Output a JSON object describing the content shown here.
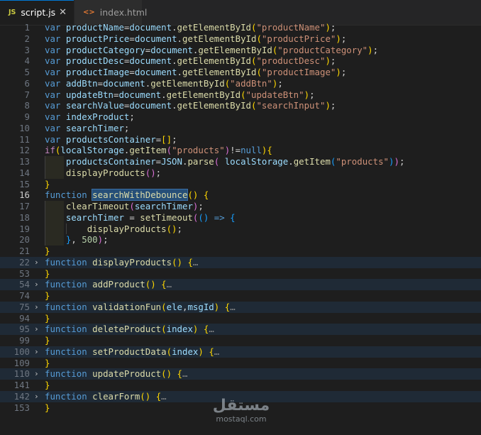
{
  "tabs": [
    {
      "icon": "JS",
      "label": "script.js",
      "close": "✕"
    },
    {
      "icon": "<>",
      "label": "index.html"
    }
  ],
  "lines": [
    {
      "n": "1",
      "t": [
        [
          "kw",
          "var"
        ],
        [
          "op",
          " "
        ],
        [
          "vr",
          "productName"
        ],
        [
          "op",
          "="
        ],
        [
          "vr",
          "document"
        ],
        [
          "op",
          "."
        ],
        [
          "fn",
          "getElementById"
        ],
        [
          "b1",
          "("
        ],
        [
          "st",
          "\"productName\""
        ],
        [
          "b1",
          ")"
        ],
        [
          "op",
          ";"
        ]
      ]
    },
    {
      "n": "2",
      "t": [
        [
          "kw",
          "var"
        ],
        [
          "op",
          " "
        ],
        [
          "vr",
          "productPrice"
        ],
        [
          "op",
          "="
        ],
        [
          "vr",
          "document"
        ],
        [
          "op",
          "."
        ],
        [
          "fn",
          "getElementById"
        ],
        [
          "b1",
          "("
        ],
        [
          "st",
          "\"productPrice\""
        ],
        [
          "b1",
          ")"
        ],
        [
          "op",
          ";"
        ]
      ]
    },
    {
      "n": "3",
      "t": [
        [
          "kw",
          "var"
        ],
        [
          "op",
          " "
        ],
        [
          "vr",
          "productCategory"
        ],
        [
          "op",
          "="
        ],
        [
          "vr",
          "document"
        ],
        [
          "op",
          "."
        ],
        [
          "fn",
          "getElementById"
        ],
        [
          "b1",
          "("
        ],
        [
          "st",
          "\"productCategory\""
        ],
        [
          "b1",
          ")"
        ],
        [
          "op",
          ";"
        ]
      ]
    },
    {
      "n": "4",
      "t": [
        [
          "kw",
          "var"
        ],
        [
          "op",
          " "
        ],
        [
          "vr",
          "productDesc"
        ],
        [
          "op",
          "="
        ],
        [
          "vr",
          "document"
        ],
        [
          "op",
          "."
        ],
        [
          "fn",
          "getElementById"
        ],
        [
          "b1",
          "("
        ],
        [
          "st",
          "\"productDesc\""
        ],
        [
          "b1",
          ")"
        ],
        [
          "op",
          ";"
        ]
      ]
    },
    {
      "n": "5",
      "t": [
        [
          "kw",
          "var"
        ],
        [
          "op",
          " "
        ],
        [
          "vr",
          "productImage"
        ],
        [
          "op",
          "="
        ],
        [
          "vr",
          "document"
        ],
        [
          "op",
          "."
        ],
        [
          "fn",
          "getElementById"
        ],
        [
          "b1",
          "("
        ],
        [
          "st",
          "\"productImage\""
        ],
        [
          "b1",
          ")"
        ],
        [
          "op",
          ";"
        ]
      ]
    },
    {
      "n": "6",
      "t": [
        [
          "kw",
          "var"
        ],
        [
          "op",
          " "
        ],
        [
          "vr",
          "addBtn"
        ],
        [
          "op",
          "="
        ],
        [
          "vr",
          "document"
        ],
        [
          "op",
          "."
        ],
        [
          "fn",
          "getElementById"
        ],
        [
          "b1",
          "("
        ],
        [
          "st",
          "\"addBtn\""
        ],
        [
          "b1",
          ")"
        ],
        [
          "op",
          ";"
        ]
      ]
    },
    {
      "n": "7",
      "t": [
        [
          "kw",
          "var"
        ],
        [
          "op",
          " "
        ],
        [
          "vr",
          "updateBtn"
        ],
        [
          "op",
          "="
        ],
        [
          "vr",
          "document"
        ],
        [
          "op",
          "."
        ],
        [
          "fn",
          "getElementById"
        ],
        [
          "b1",
          "("
        ],
        [
          "st",
          "\"updateBtn\""
        ],
        [
          "b1",
          ")"
        ],
        [
          "op",
          ";"
        ]
      ]
    },
    {
      "n": "8",
      "t": [
        [
          "kw",
          "var"
        ],
        [
          "op",
          " "
        ],
        [
          "vr",
          "searchValue"
        ],
        [
          "op",
          "="
        ],
        [
          "vr",
          "document"
        ],
        [
          "op",
          "."
        ],
        [
          "fn",
          "getElementById"
        ],
        [
          "b1",
          "("
        ],
        [
          "st",
          "\"searchInput\""
        ],
        [
          "b1",
          ")"
        ],
        [
          "op",
          ";"
        ]
      ]
    },
    {
      "n": "9",
      "t": [
        [
          "kw",
          "var"
        ],
        [
          "op",
          " "
        ],
        [
          "vr",
          "indexProduct"
        ],
        [
          "op",
          ";"
        ]
      ]
    },
    {
      "n": "10",
      "t": [
        [
          "kw",
          "var"
        ],
        [
          "op",
          " "
        ],
        [
          "vr",
          "searchTimer"
        ],
        [
          "op",
          ";"
        ]
      ]
    },
    {
      "n": "11",
      "t": [
        [
          "kw",
          "var"
        ],
        [
          "op",
          " "
        ],
        [
          "vr",
          "productsContainer"
        ],
        [
          "op",
          "="
        ],
        [
          "b1",
          "[]"
        ],
        [
          "op",
          ";"
        ]
      ]
    },
    {
      "n": "12",
      "t": [
        [
          "cf",
          "if"
        ],
        [
          "b1",
          "("
        ],
        [
          "vr",
          "localStorage"
        ],
        [
          "op",
          "."
        ],
        [
          "fn",
          "getItem"
        ],
        [
          "b2",
          "("
        ],
        [
          "st",
          "\"products\""
        ],
        [
          "b2",
          ")"
        ],
        [
          "op",
          "!="
        ],
        [
          "kw",
          "null"
        ],
        [
          "b1",
          ")"
        ],
        [
          "b1",
          "{"
        ]
      ]
    },
    {
      "n": "13",
      "indent": 1,
      "t": [
        [
          "op",
          "    "
        ],
        [
          "vr",
          "productsContainer"
        ],
        [
          "op",
          "="
        ],
        [
          "vr",
          "JSON"
        ],
        [
          "op",
          "."
        ],
        [
          "fn",
          "parse"
        ],
        [
          "b2",
          "("
        ],
        [
          "op",
          " "
        ],
        [
          "vr",
          "localStorage"
        ],
        [
          "op",
          "."
        ],
        [
          "fn",
          "getItem"
        ],
        [
          "b3",
          "("
        ],
        [
          "st",
          "\"products\""
        ],
        [
          "b3",
          ")"
        ],
        [
          "b2",
          ")"
        ],
        [
          "op",
          ";"
        ]
      ]
    },
    {
      "n": "14",
      "indent": 1,
      "t": [
        [
          "op",
          "    "
        ],
        [
          "fn",
          "displayProducts"
        ],
        [
          "b2",
          "()"
        ],
        [
          "op",
          ";"
        ]
      ]
    },
    {
      "n": "15",
      "t": [
        [
          "b1",
          "}"
        ]
      ]
    },
    {
      "n": "16",
      "current": true,
      "t": [
        [
          "kw",
          "function"
        ],
        [
          "op",
          " "
        ],
        [
          "fn",
          "searchWithDebounce",
          "sel"
        ],
        [
          "b1",
          "()"
        ],
        [
          "op",
          " "
        ],
        [
          "b1",
          "{"
        ]
      ]
    },
    {
      "n": "17",
      "indent": 1,
      "t": [
        [
          "op",
          "    "
        ],
        [
          "fn",
          "clearTimeout"
        ],
        [
          "b2",
          "("
        ],
        [
          "vr",
          "searchTimer"
        ],
        [
          "b2",
          ")"
        ],
        [
          "op",
          ";"
        ]
      ]
    },
    {
      "n": "18",
      "indent": 1,
      "t": [
        [
          "op",
          "    "
        ],
        [
          "vr",
          "searchTimer"
        ],
        [
          "op",
          " = "
        ],
        [
          "fn",
          "setTimeout"
        ],
        [
          "b2",
          "("
        ],
        [
          "b3",
          "()"
        ],
        [
          "op",
          " "
        ],
        [
          "kw",
          "=>"
        ],
        [
          "op",
          " "
        ],
        [
          "b3",
          "{"
        ]
      ]
    },
    {
      "n": "19",
      "indent": 2,
      "t": [
        [
          "op",
          "        "
        ],
        [
          "fn",
          "displayProducts"
        ],
        [
          "b1",
          "()"
        ],
        [
          "op",
          ";"
        ]
      ]
    },
    {
      "n": "20",
      "indent": 1,
      "t": [
        [
          "op",
          "    "
        ],
        [
          "b3",
          "}"
        ],
        [
          "op",
          ", "
        ],
        [
          "nm",
          "500"
        ],
        [
          "b2",
          ")"
        ],
        [
          "op",
          ";"
        ]
      ]
    },
    {
      "n": "21",
      "t": [
        [
          "b1",
          "}"
        ]
      ]
    },
    {
      "n": "22",
      "folded": true,
      "t": [
        [
          "kw",
          "function"
        ],
        [
          "op",
          " "
        ],
        [
          "fn",
          "displayProducts"
        ],
        [
          "b1",
          "()"
        ],
        [
          "op",
          " "
        ],
        [
          "b1",
          "{"
        ],
        [
          "ell",
          "…"
        ]
      ]
    },
    {
      "n": "53",
      "t": [
        [
          "b1",
          "}"
        ]
      ]
    },
    {
      "n": "54",
      "folded": true,
      "t": [
        [
          "kw",
          "function"
        ],
        [
          "op",
          " "
        ],
        [
          "fn",
          "addProduct"
        ],
        [
          "b1",
          "()"
        ],
        [
          "op",
          " "
        ],
        [
          "b1",
          "{"
        ],
        [
          "ell",
          "…"
        ]
      ]
    },
    {
      "n": "74",
      "t": [
        [
          "b1",
          "}"
        ]
      ]
    },
    {
      "n": "75",
      "folded": true,
      "t": [
        [
          "kw",
          "function"
        ],
        [
          "op",
          " "
        ],
        [
          "fn",
          "validationFun"
        ],
        [
          "b1",
          "("
        ],
        [
          "vr",
          "ele"
        ],
        [
          "op",
          ","
        ],
        [
          "vr",
          "msgId"
        ],
        [
          "b1",
          ")"
        ],
        [
          "op",
          " "
        ],
        [
          "b1",
          "{"
        ],
        [
          "ell",
          "…"
        ]
      ]
    },
    {
      "n": "94",
      "t": [
        [
          "b1",
          "}"
        ]
      ]
    },
    {
      "n": "95",
      "folded": true,
      "t": [
        [
          "kw",
          "function"
        ],
        [
          "op",
          " "
        ],
        [
          "fn",
          "deleteProduct"
        ],
        [
          "b1",
          "("
        ],
        [
          "vr",
          "index"
        ],
        [
          "b1",
          ")"
        ],
        [
          "op",
          " "
        ],
        [
          "b1",
          "{"
        ],
        [
          "ell",
          "…"
        ]
      ]
    },
    {
      "n": "99",
      "t": [
        [
          "b1",
          "}"
        ]
      ]
    },
    {
      "n": "100",
      "folded": true,
      "t": [
        [
          "kw",
          "function"
        ],
        [
          "op",
          " "
        ],
        [
          "fn",
          "setProductData"
        ],
        [
          "b1",
          "("
        ],
        [
          "vr",
          "index"
        ],
        [
          "b1",
          ")"
        ],
        [
          "op",
          " "
        ],
        [
          "b1",
          "{"
        ],
        [
          "ell",
          "…"
        ]
      ]
    },
    {
      "n": "109",
      "t": [
        [
          "b1",
          "}"
        ]
      ]
    },
    {
      "n": "110",
      "folded": true,
      "t": [
        [
          "kw",
          "function"
        ],
        [
          "op",
          " "
        ],
        [
          "fn",
          "updateProduct"
        ],
        [
          "b1",
          "()"
        ],
        [
          "op",
          " "
        ],
        [
          "b1",
          "{"
        ],
        [
          "ell",
          "…"
        ]
      ]
    },
    {
      "n": "141",
      "t": [
        [
          "b1",
          "}"
        ]
      ]
    },
    {
      "n": "142",
      "folded": true,
      "t": [
        [
          "kw",
          "function"
        ],
        [
          "op",
          " "
        ],
        [
          "fn",
          "clearForm"
        ],
        [
          "b1",
          "()"
        ],
        [
          "op",
          " "
        ],
        [
          "b1",
          "{"
        ],
        [
          "ell",
          "…"
        ]
      ]
    },
    {
      "n": "153",
      "t": [
        [
          "b1",
          "}"
        ]
      ]
    }
  ],
  "fold_icon": "›",
  "watermark": {
    "logo": "مستقل",
    "site": "mostaql.com"
  }
}
